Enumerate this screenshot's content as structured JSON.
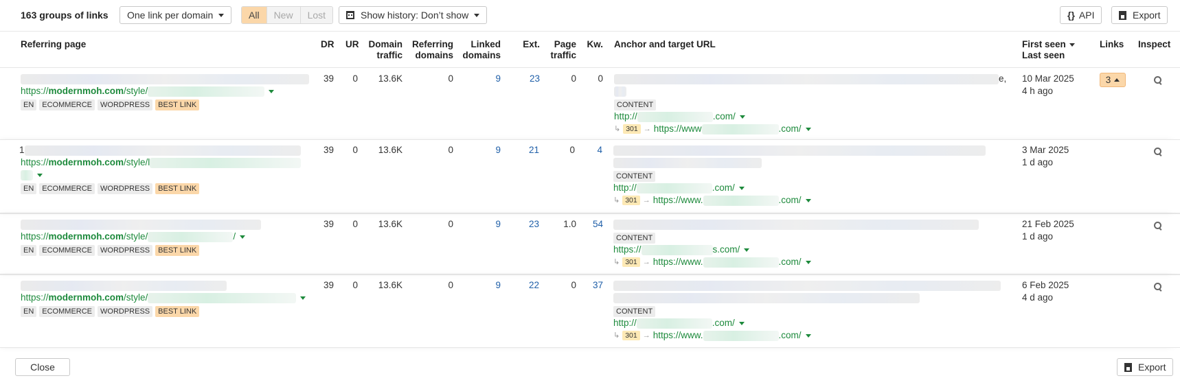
{
  "toolbar": {
    "groups_count": "163 groups of links",
    "grouping": "One link per domain",
    "filter_all": "All",
    "filter_new": "New",
    "filter_lost": "Lost",
    "history": "Show history: Don’t show",
    "api": "API",
    "export": "Export"
  },
  "headers": {
    "referring_page": "Referring page",
    "dr": "DR",
    "ur": "UR",
    "domain_traffic_1": "Domain",
    "domain_traffic_2": "traffic",
    "referring_domains_1": "Referring",
    "referring_domains_2": "domains",
    "linked_domains_1": "Linked",
    "linked_domains_2": "domains",
    "ext": "Ext.",
    "page_traffic_1": "Page",
    "page_traffic_2": "traffic",
    "kw": "Kw.",
    "anchor": "Anchor and target URL",
    "first_seen": "First seen",
    "last_seen": "Last seen",
    "links": "Links",
    "inspect": "Inspect"
  },
  "rows": [
    {
      "url_prefix": "https://",
      "url_domain": "modernmoh.com",
      "url_path": "/style/",
      "tags": [
        "EN",
        "ECOMMERCE",
        "WORDPRESS",
        "BEST LINK"
      ],
      "dr": "39",
      "ur": "0",
      "domain_traffic": "13.6K",
      "referring_domains": "0",
      "linked_domains": "9",
      "ext": "23",
      "page_traffic": "0",
      "kw": "0",
      "anchor_tail": "e,",
      "content_tag": "CONTENT",
      "target_prefix": "http://",
      "target_suffix": ".com/",
      "redirect_code": "301",
      "redirect_prefix": "https://www",
      "redirect_suffix": ".com/",
      "first_seen": "10 Mar 2025",
      "last_seen": "4 h ago",
      "links": "3"
    },
    {
      "url_prefix": "https://",
      "url_domain": "modernmoh.com",
      "url_path": "/style/l",
      "tags": [
        "EN",
        "ECOMMERCE",
        "WORDPRESS",
        "BEST LINK"
      ],
      "dr": "39",
      "ur": "0",
      "domain_traffic": "13.6K",
      "referring_domains": "0",
      "linked_domains": "9",
      "ext": "21",
      "page_traffic": "0",
      "kw": "4",
      "content_tag": "CONTENT",
      "target_prefix": "http://",
      "target_suffix": ".com/",
      "redirect_code": "301",
      "redirect_prefix": "https://www.",
      "redirect_suffix": ".com/",
      "first_seen": "3 Mar 2025",
      "last_seen": "1 d ago"
    },
    {
      "url_prefix": "https://",
      "url_domain": "modernmoh.com",
      "url_path": "/style/",
      "url_tail": "/",
      "tags": [
        "EN",
        "ECOMMERCE",
        "WORDPRESS",
        "BEST LINK"
      ],
      "dr": "39",
      "ur": "0",
      "domain_traffic": "13.6K",
      "referring_domains": "0",
      "linked_domains": "9",
      "ext": "23",
      "page_traffic": "1.0",
      "kw": "54",
      "content_tag": "CONTENT",
      "target_prefix": "https://",
      "target_suffix": "s.com/",
      "redirect_code": "301",
      "redirect_prefix": "https://www.",
      "redirect_suffix": ".com/",
      "first_seen": "21 Feb 2025",
      "last_seen": "1 d ago"
    },
    {
      "url_prefix": "https://",
      "url_domain": "modernmoh.com",
      "url_path": "/style/",
      "tags": [
        "EN",
        "ECOMMERCE",
        "WORDPRESS",
        "BEST LINK"
      ],
      "dr": "39",
      "ur": "0",
      "domain_traffic": "13.6K",
      "referring_domains": "0",
      "linked_domains": "9",
      "ext": "22",
      "page_traffic": "0",
      "kw": "37",
      "content_tag": "CONTENT",
      "target_prefix": "http://",
      "target_suffix": ".com/",
      "redirect_code": "301",
      "redirect_prefix": "https://www.",
      "redirect_suffix": ".com/",
      "first_seen": "6 Feb 2025",
      "last_seen": "4 d ago"
    }
  ],
  "footer": {
    "close": "Close",
    "export": "Export"
  },
  "icons": {
    "api": "braces-icon",
    "export": "export-icon",
    "history": "calendar-icon",
    "inspect": "magnifier-icon"
  }
}
